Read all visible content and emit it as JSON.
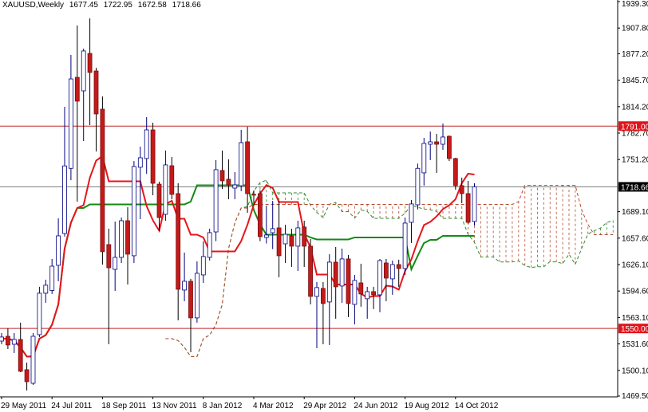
{
  "header": {
    "symbol": "XAUUSD,Weekly",
    "open": "1677.45",
    "high": "1722.95",
    "low": "1672.58",
    "close": "1718.66"
  },
  "colors": {
    "bull_body": "#ffffff",
    "bull_outline": "#000080",
    "bear_body": "#c41a1a",
    "wick": "#000000",
    "tenkan": "#e8141b",
    "kijun": "#138a13",
    "span_a": "#2e8b2e",
    "span_b": "#b5482b",
    "level_line": "#c0262a",
    "price_line": "#808080"
  },
  "chart_data": {
    "type": "candlestick",
    "title": "XAUUSD,Weekly",
    "ylim": [
      1469.5,
      1939.3
    ],
    "y_ticks": [
      "1939.30",
      "1907.80",
      "1877.20",
      "1845.70",
      "1814.20",
      "1782.70",
      "1751.20",
      "1689.10",
      "1657.60",
      "1626.10",
      "1594.60",
      "1563.10",
      "1531.60",
      "1500.10",
      "1469.50"
    ],
    "x_labels": [
      {
        "index": 0,
        "label": "29 May 2011"
      },
      {
        "index": 8,
        "label": "24 Jul 2011"
      },
      {
        "index": 16,
        "label": "18 Sep 2011"
      },
      {
        "index": 24,
        "label": "13 Nov 2011"
      },
      {
        "index": 32,
        "label": "8 Jan 2012"
      },
      {
        "index": 40,
        "label": "4 Mar 2012"
      },
      {
        "index": 48,
        "label": "29 Apr 2012"
      },
      {
        "index": 56,
        "label": "24 Jun 2012"
      },
      {
        "index": 64,
        "label": "19 Aug 2012"
      },
      {
        "index": 72,
        "label": "14 Oct 2012"
      }
    ],
    "levels": [
      {
        "name": "resistance",
        "value": 1791.0,
        "label": "1791.00"
      },
      {
        "name": "support",
        "value": 1550.0,
        "label": "1550.00"
      }
    ],
    "current_price": {
      "value": 1718.66,
      "label": "1718.66"
    },
    "indicator": "Ichimoku (9,26,52)",
    "ohlc": [
      [
        1535.0,
        1544.5,
        1531.2,
        1539.8
      ],
      [
        1540.7,
        1550.2,
        1525.5,
        1530.3
      ],
      [
        1531.2,
        1544.5,
        1520.8,
        1536.9
      ],
      [
        1536.9,
        1556.9,
        1498.0,
        1499.0
      ],
      [
        1500.9,
        1509.4,
        1476.2,
        1486.6
      ],
      [
        1484.7,
        1544.5,
        1482.8,
        1540.7
      ],
      [
        1542.6,
        1599.6,
        1539.8,
        1592.0
      ],
      [
        1592.0,
        1608.1,
        1580.6,
        1601.5
      ],
      [
        1595.3,
        1632.8,
        1591.1,
        1624.2
      ],
      [
        1625.2,
        1681.2,
        1606.2,
        1660.3
      ],
      [
        1663.1,
        1814.0,
        1659.4,
        1743.6
      ],
      [
        1740.7,
        1875.7,
        1726.6,
        1847.2
      ],
      [
        1849.1,
        1910.8,
        1701.1,
        1820.7
      ],
      [
        1833.0,
        1883.3,
        1773.2,
        1880.5
      ],
      [
        1877.6,
        1919.3,
        1792.2,
        1854.9
      ],
      [
        1856.7,
        1860.5,
        1760.7,
        1805.5
      ],
      [
        1811.2,
        1826.4,
        1626.1,
        1641.4
      ],
      [
        1649.9,
        1668.8,
        1531.2,
        1622.3
      ],
      [
        1620.4,
        1677.4,
        1594.8,
        1634.7
      ],
      [
        1634.7,
        1682.1,
        1628.0,
        1678.3
      ],
      [
        1678.3,
        1694.4,
        1602.4,
        1638.5
      ],
      [
        1636.6,
        1749.4,
        1628.0,
        1742.9
      ],
      [
        1742.0,
        1766.6,
        1680.2,
        1753.3
      ],
      [
        1752.4,
        1801.7,
        1734.3,
        1786.5
      ],
      [
        1786.5,
        1795.1,
        1708.7,
        1722.9
      ],
      [
        1721.9,
        1724.8,
        1666.0,
        1682.1
      ],
      [
        1685.9,
        1761.9,
        1678.3,
        1744.8
      ],
      [
        1743.8,
        1754.2,
        1703.9,
        1709.7
      ],
      [
        1710.6,
        1723.0,
        1559.7,
        1596.7
      ],
      [
        1595.8,
        1640.4,
        1582.5,
        1606.2
      ],
      [
        1606.2,
        1609.1,
        1521.7,
        1562.6
      ],
      [
        1562.6,
        1630.0,
        1556.9,
        1615.7
      ],
      [
        1613.8,
        1653.7,
        1604.3,
        1635.7
      ],
      [
        1634.7,
        1668.8,
        1630.9,
        1664.1
      ],
      [
        1665.0,
        1750.5,
        1654.0,
        1739.1
      ],
      [
        1738.2,
        1761.9,
        1716.3,
        1725.8
      ],
      [
        1727.7,
        1751.4,
        1703.9,
        1721.0
      ],
      [
        1717.2,
        1736.2,
        1703.9,
        1721.0
      ],
      [
        1720.0,
        1786.5,
        1713.5,
        1771.3
      ],
      [
        1772.3,
        1790.3,
        1687.8,
        1710.6
      ],
      [
        1709.7,
        1714.4,
        1697.0,
        1709.0
      ],
      [
        1710.6,
        1714.4,
        1654.0,
        1659.4
      ],
      [
        1658.4,
        1696.3,
        1651.2,
        1661.3
      ],
      [
        1664.1,
        1702.0,
        1644.5,
        1668.9
      ],
      [
        1669.8,
        1702.0,
        1611.0,
        1636.6
      ],
      [
        1650.8,
        1673.6,
        1628.0,
        1662.2
      ],
      [
        1660.3,
        1668.8,
        1623.3,
        1648.0
      ],
      [
        1648.0,
        1678.3,
        1618.5,
        1669.8
      ],
      [
        1670.8,
        1678.3,
        1623.3,
        1648.0
      ],
      [
        1648.0,
        1656.5,
        1578.7,
        1588.2
      ],
      [
        1588.2,
        1605.3,
        1526.5,
        1598.7
      ],
      [
        1597.7,
        1605.3,
        1531.2,
        1579.7
      ],
      [
        1581.6,
        1638.5,
        1530.3,
        1629.0
      ],
      [
        1629.0,
        1647.0,
        1561.6,
        1599.6
      ],
      [
        1600.6,
        1645.1,
        1580.6,
        1632.8
      ],
      [
        1632.8,
        1637.6,
        1563.5,
        1579.7
      ],
      [
        1578.7,
        1613.8,
        1554.9,
        1607.2
      ],
      [
        1604.3,
        1627.1,
        1575.9,
        1591.1
      ],
      [
        1585.4,
        1599.6,
        1561.6,
        1593.9
      ],
      [
        1593.9,
        1599.6,
        1573.1,
        1590.1
      ],
      [
        1590.1,
        1632.8,
        1569.4,
        1630.9
      ],
      [
        1628.0,
        1632.8,
        1582.5,
        1610.0
      ],
      [
        1609.1,
        1630.9,
        1590.1,
        1626.1
      ],
      [
        1626.1,
        1631.9,
        1599.6,
        1621.4
      ],
      [
        1621.4,
        1682.1,
        1613.8,
        1675.5
      ],
      [
        1676.4,
        1703.0,
        1651.9,
        1698.3
      ],
      [
        1697.3,
        1746.4,
        1691.7,
        1740.7
      ],
      [
        1735.3,
        1777.0,
        1720.1,
        1770.4
      ],
      [
        1769.4,
        1784.6,
        1750.5,
        1772.3
      ],
      [
        1772.3,
        1781.8,
        1735.3,
        1769.4
      ],
      [
        1769.4,
        1794.1,
        1762.8,
        1778.0
      ],
      [
        1778.9,
        1779.9,
        1749.5,
        1752.4
      ],
      [
        1752.4,
        1753.3,
        1715.3,
        1720.1
      ],
      [
        1720.1,
        1729.6,
        1699.2,
        1710.6
      ],
      [
        1710.6,
        1725.8,
        1674.6,
        1676.4
      ],
      [
        1677.45,
        1722.95,
        1672.58,
        1718.66
      ]
    ]
  }
}
